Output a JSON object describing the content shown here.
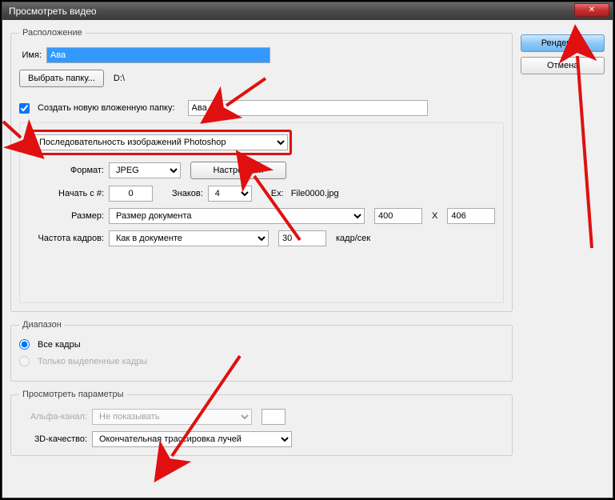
{
  "window": {
    "title": "Просмотреть видео"
  },
  "buttons": {
    "render": "Рендеринг",
    "cancel": "Отмена",
    "selectFolder": "Выбрать папку...",
    "settings": "Настройки..."
  },
  "location": {
    "legend": "Расположение",
    "nameLabel": "Имя:",
    "nameValue": "Ава",
    "path": "D:\\",
    "createSubfolderLabel": "Создать новую вложенную папку:",
    "subfolderValue": "Ава"
  },
  "sequence": {
    "typeValue": "Последовательность изображений Photoshop",
    "formatLabel": "Формат:",
    "formatValue": "JPEG",
    "startLabel": "Начать с #:",
    "startValue": "0",
    "digitsLabel": "Знаков:",
    "digitsValue": "4",
    "exLabel": "Ex:",
    "exValue": "File0000.jpg",
    "sizeLabel": "Размер:",
    "sizeValue": "Размер документа",
    "width": "400",
    "x": "X",
    "height": "406",
    "fpsLabel": "Частота кадров:",
    "fpsMode": "Как в документе",
    "fpsValue": "30",
    "fpsUnit": "кадр/сек"
  },
  "range": {
    "legend": "Диапазон",
    "allFrames": "Все кадры",
    "selectedFrames": "Только выделенные кадры"
  },
  "preview": {
    "legend": "Просмотреть параметры",
    "alphaLabel": "Альфа-канал:",
    "alphaValue": "Не показывать",
    "qualityLabel": "3D-качество:",
    "qualityValue": "Окончательная трассировка лучей"
  }
}
